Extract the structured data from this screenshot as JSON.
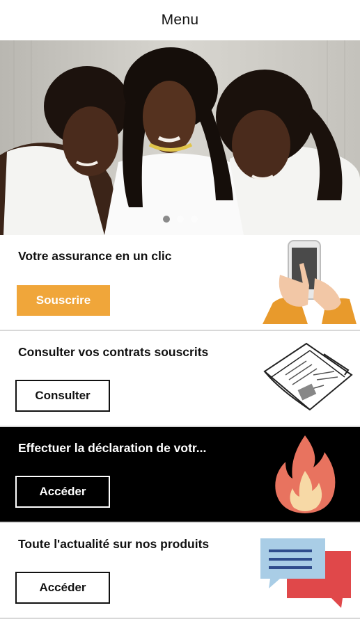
{
  "header": {
    "title": "Menu"
  },
  "hero": {
    "slides": 3,
    "active_slide": 0
  },
  "cards": [
    {
      "title": "Votre assurance en un clic",
      "button": "Souscrire",
      "icon": "hand-phone-icon",
      "button_color": "#f0a63a"
    },
    {
      "title": "Consulter vos contrats souscrits",
      "button": "Consulter",
      "icon": "newspaper-icon"
    },
    {
      "title": "Effectuer la déclaration de votr...",
      "button": "Accéder",
      "icon": "fire-icon"
    },
    {
      "title": "Toute l'actualité sur nos produits",
      "button": "Accéder",
      "icon": "chat-bubbles-icon"
    }
  ]
}
